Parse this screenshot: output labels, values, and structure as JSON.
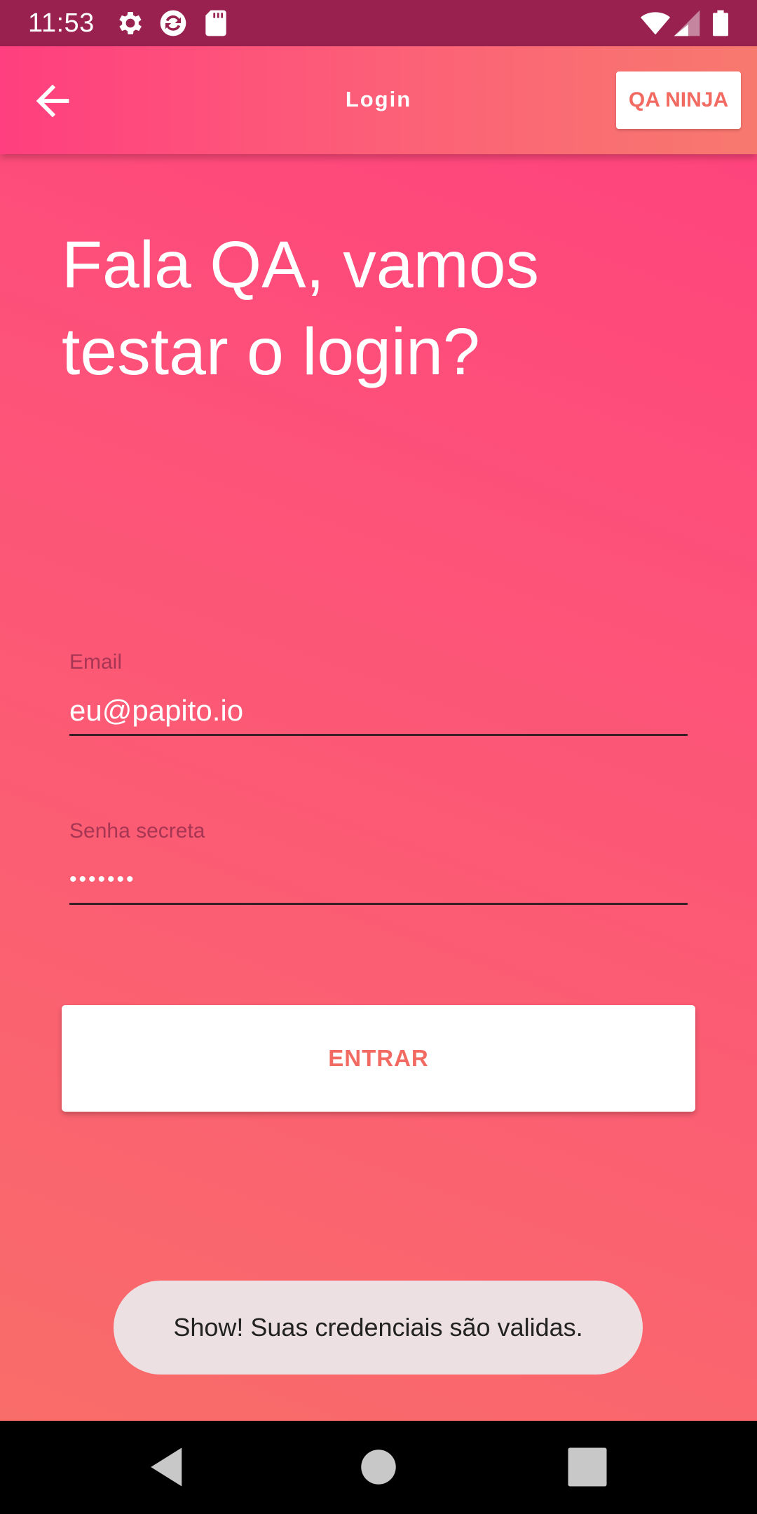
{
  "status_bar": {
    "time": "11:53",
    "left_icons": [
      "gear-icon",
      "sync-icon",
      "sd-card-icon"
    ],
    "right_icons": [
      "wifi-icon",
      "cellular-signal-icon",
      "battery-icon"
    ],
    "background_color": "#98214f"
  },
  "app_bar": {
    "back_icon": "arrow-back-icon",
    "title": "Login",
    "brand_button_label": "QA NINJA"
  },
  "main": {
    "heading": "Fala QA, vamos testar o login?",
    "email_field": {
      "label": "Email",
      "value": "eu@papito.io"
    },
    "password_field": {
      "label": "Senha secreta",
      "value": "•••••••"
    },
    "enter_button_label": "ENTRAR"
  },
  "toast": {
    "message": "Show! Suas credenciais são validas."
  },
  "nav_bar": {
    "icons": [
      "back-triangle-icon",
      "home-circle-icon",
      "recents-square-icon"
    ]
  },
  "colors": {
    "accent_text": "#f26b62",
    "gradient_top": "#ff3f7d",
    "gradient_bottom": "#f86f68",
    "field_label": "#a73654",
    "toast_background": "#ece0e2"
  }
}
